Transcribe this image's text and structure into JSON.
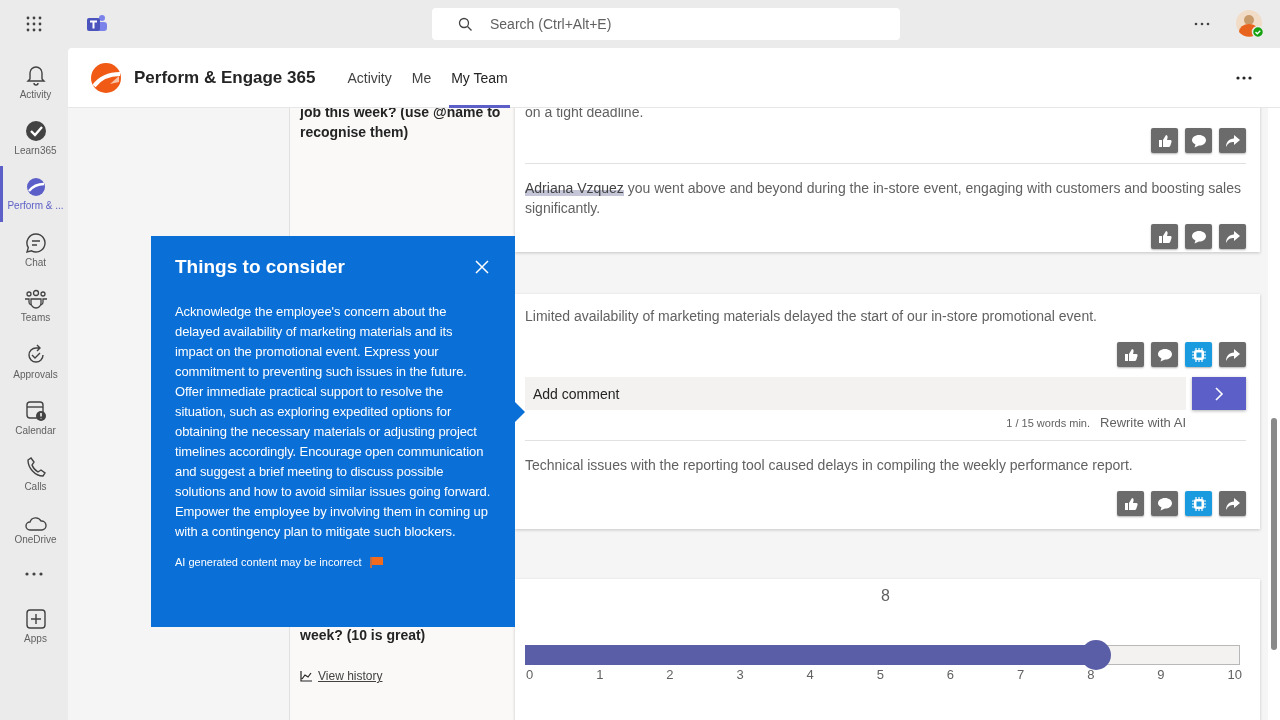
{
  "top_bar": {
    "search": {
      "placeholder": "Search (Ctrl+Alt+E)"
    }
  },
  "rail": {
    "items": [
      {
        "label": "Activity",
        "selected": false
      },
      {
        "label": "Learn365",
        "selected": false
      },
      {
        "label": "Perform & ...",
        "selected": true
      },
      {
        "label": "Chat",
        "selected": false
      },
      {
        "label": "Teams",
        "selected": false
      },
      {
        "label": "Approvals",
        "selected": false
      },
      {
        "label": "Calendar",
        "selected": false
      },
      {
        "label": "Calls",
        "selected": false
      },
      {
        "label": "OneDrive",
        "selected": false
      },
      {
        "label": "Apps",
        "selected": false
      }
    ]
  },
  "app": {
    "title": "Perform & Engage 365",
    "tabs": [
      {
        "label": "Activity",
        "selected": false
      },
      {
        "label": "Me",
        "selected": false
      },
      {
        "label": "My Team",
        "selected": true
      }
    ]
  },
  "sections": [
    {
      "question": "job this week? (use @name to recognise them)",
      "answers": [
        {
          "text": "on a tight deadline.",
          "actions": [
            {
              "kind": "like"
            },
            {
              "kind": "comment"
            },
            {
              "kind": "share"
            }
          ]
        },
        {
          "mention": "Adriana Vzquez",
          "text": " you went above and beyond during the in-store event, engaging with customers and boosting sales significantly.",
          "actions": [
            {
              "kind": "like"
            },
            {
              "kind": "comment"
            },
            {
              "kind": "share"
            }
          ]
        }
      ]
    },
    {
      "answers": [
        {
          "text": "Limited availability of marketing materials delayed the start of our in-store promotional event.",
          "actions": [
            {
              "kind": "like"
            },
            {
              "kind": "comment"
            },
            {
              "kind": "ai"
            },
            {
              "kind": "share"
            }
          ],
          "comment_box": {
            "placeholder": "Add comment",
            "counter": "1 / 15 words min.",
            "rewrite": "Rewrite with AI"
          }
        },
        {
          "text": "Technical issues with the reporting tool caused delays in compiling the weekly performance report.",
          "actions": [
            {
              "kind": "like"
            },
            {
              "kind": "comment"
            },
            {
              "kind": "ai"
            },
            {
              "kind": "share"
            }
          ]
        }
      ]
    },
    {
      "question": "week? (10 is great)",
      "history_link": "View history",
      "rating": {
        "value": "8",
        "level": 0.8,
        "ticks": [
          "0",
          "1",
          "2",
          "3",
          "4",
          "5",
          "6",
          "7",
          "8",
          "9",
          "10"
        ]
      }
    }
  ],
  "popup": {
    "title": "Things to consider",
    "body": "Acknowledge the employee's concern about the delayed availability of marketing materials and its impact on the promotional event. Express your commitment to preventing such issues in the future. Offer immediate practical support to resolve the situation, such as exploring expedited options for obtaining the necessary materials or adjusting project timelines accordingly. Encourage open communication and suggest a brief meeting to discuss possible solutions and how to avoid similar issues going forward. Empower the employee by involving them in coming up with a contingency plan to mitigate such blockers.",
    "disclaimer": "AI generated content may be incorrect"
  }
}
